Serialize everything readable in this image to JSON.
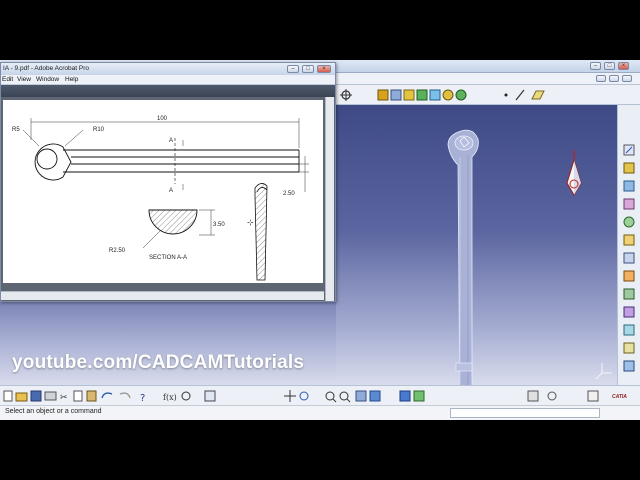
{
  "acrobat": {
    "title": "IA - 9.pdf - Adobe Acrobat Pro",
    "menu": [
      "Edit",
      "View",
      "Window",
      "Help"
    ]
  },
  "drawing": {
    "dims": {
      "r5": "R5",
      "r10": "R10",
      "length": "100",
      "thickness": "2.50",
      "height": "3.50",
      "r250": "R2.50",
      "section_marker": "A"
    },
    "section_label": "SECTION A-A"
  },
  "watermark": "youtube.com/CADCAMTutorials",
  "status": {
    "message": "Select an object or a command"
  },
  "compass_label": "CATIA",
  "colors": {
    "viewport_top": "#3e4a86",
    "viewport_bottom": "#d8dcec",
    "part_fill": "#a9b2d6"
  }
}
